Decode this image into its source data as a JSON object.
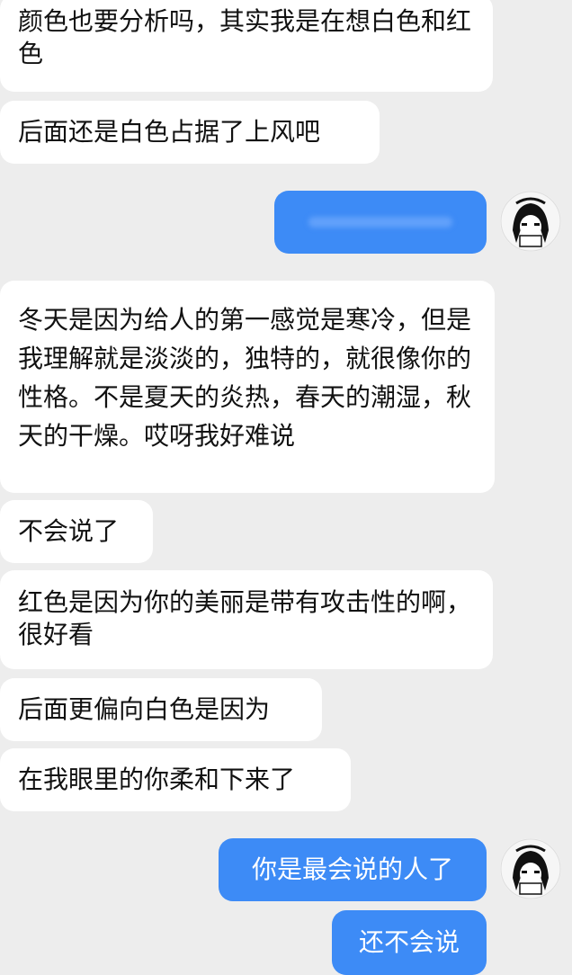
{
  "messages": [
    {
      "id": "m1",
      "side": "in",
      "text": "颜色也要分析吗，其实我是在想白色和红色"
    },
    {
      "id": "m2",
      "side": "in",
      "text": "后面还是白色占据了上风吧"
    },
    {
      "id": "m3",
      "side": "out",
      "text": ""
    },
    {
      "id": "m4",
      "side": "in",
      "text": "冬天是因为给人的第一感觉是寒冷，但是我理解就是淡淡的，独特的，就很像你的性格。不是夏天的炎热，春天的潮湿，秋天的干燥。哎呀我好难说"
    },
    {
      "id": "m5",
      "side": "in",
      "text": "不会说了"
    },
    {
      "id": "m6",
      "side": "in",
      "text": "红色是因为你的美丽是带有攻击性的啊，很好看"
    },
    {
      "id": "m7",
      "side": "in",
      "text": "后面更偏向白色是因为"
    },
    {
      "id": "m8",
      "side": "in",
      "text": "在我眼里的你柔和下来了"
    },
    {
      "id": "m9",
      "side": "out",
      "text": "你是最会说的人了"
    },
    {
      "id": "m10",
      "side": "out",
      "text": "还不会说"
    }
  ],
  "colors": {
    "background": "#ededed",
    "incoming_bubble": "#ffffff",
    "outgoing_bubble": "#3d8bf6"
  },
  "avatar": {
    "icon": "anime-girl-avatar-icon"
  }
}
